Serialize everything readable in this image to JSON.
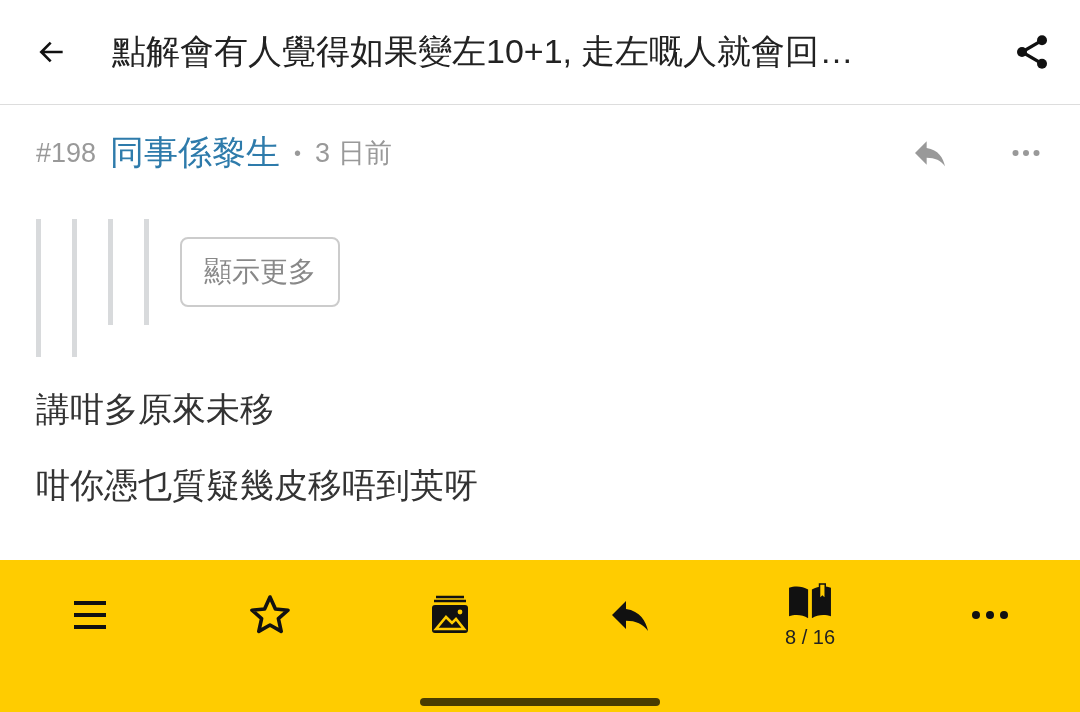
{
  "header": {
    "title": "點解會有人覺得如果變左10+1, 走左嘅人就會回…"
  },
  "post": {
    "number": "#198",
    "author": "同事係黎生",
    "separator": "•",
    "time": "3 日前",
    "quote": {
      "quote": {
        "quote": {
          "quote": {
            "more_button": "顯示更多"
          }
        }
      }
    },
    "lines": [
      "講咁多原來未移",
      "咁你憑乜質疑幾皮移唔到英呀"
    ]
  },
  "toolbar": {
    "items": [
      {
        "kind": "menu"
      },
      {
        "kind": "star"
      },
      {
        "kind": "images"
      },
      {
        "kind": "reply"
      },
      {
        "kind": "pages",
        "label": "8 / 16"
      },
      {
        "kind": "more"
      }
    ]
  }
}
